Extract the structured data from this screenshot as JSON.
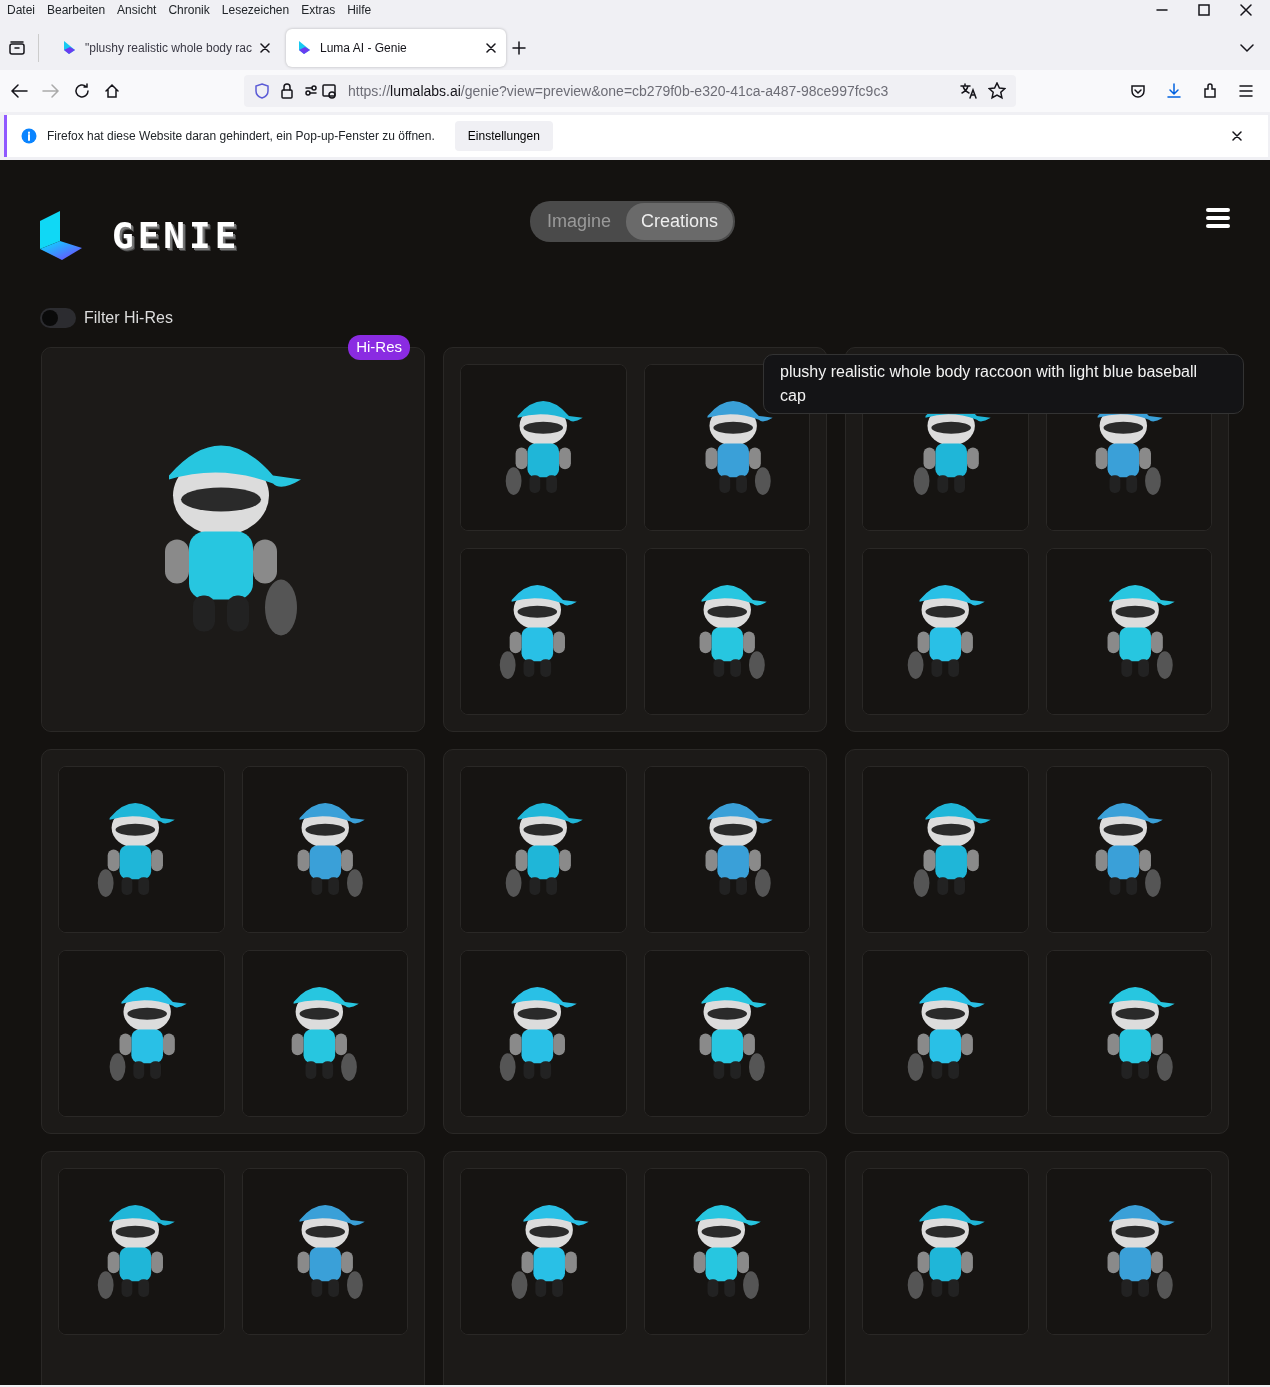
{
  "browser": {
    "menu": [
      "Datei",
      "Bearbeiten",
      "Ansicht",
      "Chronik",
      "Lesezeichen",
      "Extras",
      "Hilfe"
    ],
    "tabs": [
      {
        "title": "\"plushy realistic whole body rac",
        "selected": false
      },
      {
        "title": "Luma AI - Genie",
        "selected": true
      }
    ],
    "url": {
      "scheme": "https://",
      "host": "lumalabs.ai",
      "path": "/genie?view=preview&one=cb279f0b-e320-41ca-a487-98ce997fc9c3"
    },
    "notification": {
      "text": "Firefox hat diese Website daran gehindert, ein Pop-up-Fenster zu öffnen.",
      "button": "Einstellungen"
    }
  },
  "app": {
    "logo": "GENIE",
    "modes": [
      {
        "label": "Imagine",
        "selected": false
      },
      {
        "label": "Creations",
        "selected": true
      }
    ],
    "filter": {
      "label": "Filter Hi-Res",
      "on": false
    },
    "creations": [
      {
        "kind": "single",
        "badge": "Hi-Res"
      },
      {
        "kind": "grid"
      },
      {
        "kind": "grid"
      },
      {
        "kind": "grid"
      },
      {
        "kind": "grid"
      },
      {
        "kind": "grid"
      },
      {
        "kind": "grid"
      },
      {
        "kind": "grid"
      },
      {
        "kind": "grid"
      }
    ],
    "tooltip": "plushy realistic whole body raccoon with light blue baseball cap"
  }
}
